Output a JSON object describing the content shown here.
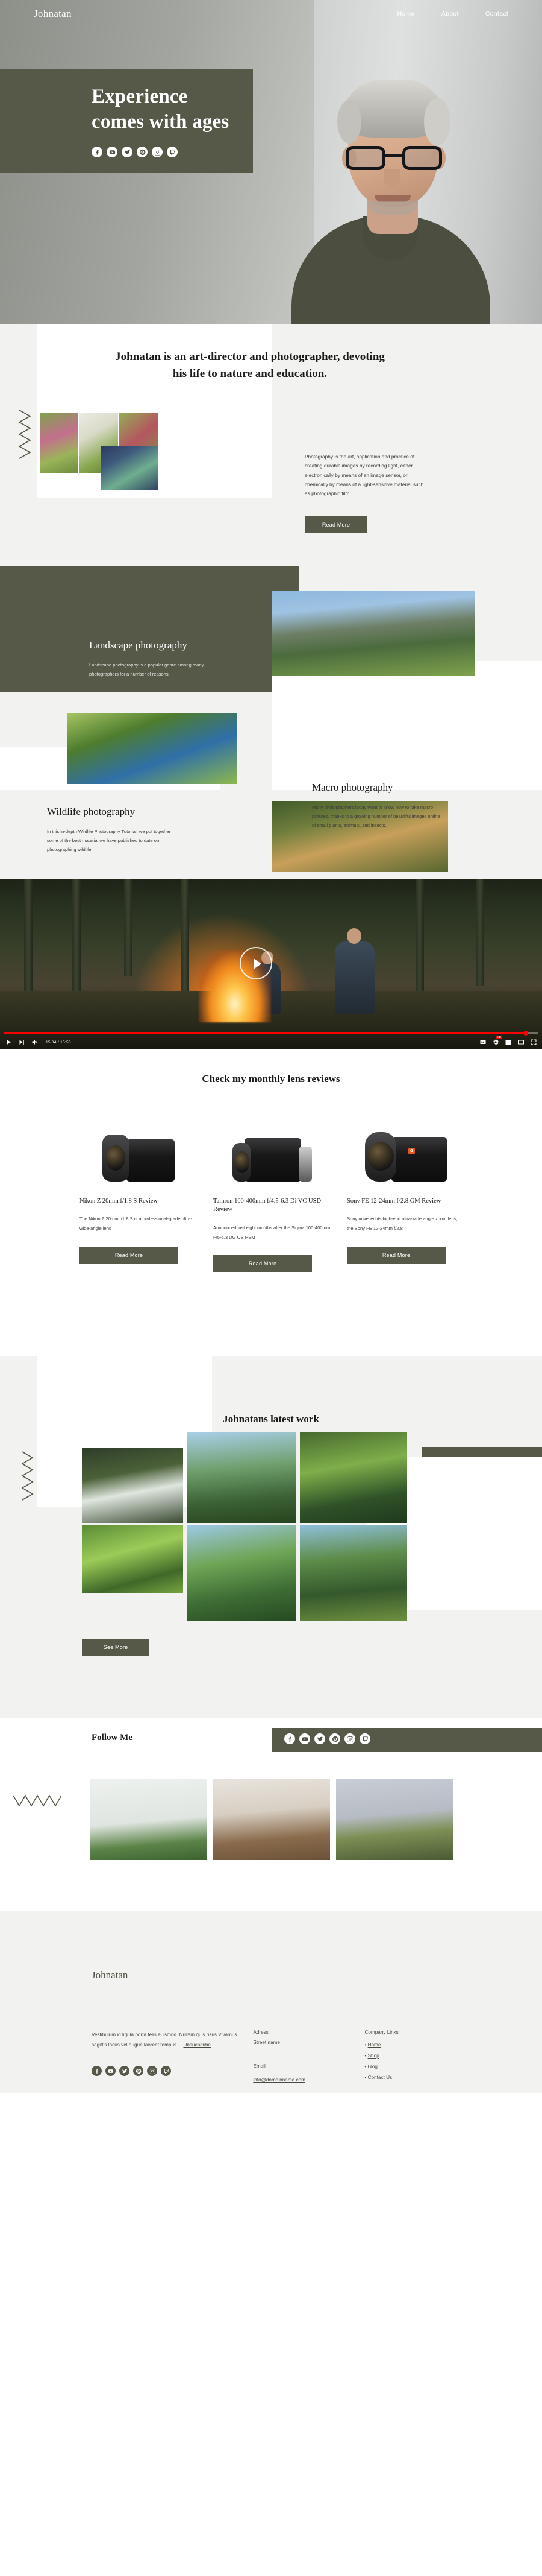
{
  "colors": {
    "olive": "#565948",
    "light_bg": "#f2f2f0",
    "white": "#ffffff",
    "accent_red": "#ff0000"
  },
  "nav": {
    "brand": "Johnatan",
    "links": [
      {
        "label": "Home"
      },
      {
        "label": "About"
      },
      {
        "label": "Contact"
      }
    ]
  },
  "hero": {
    "title_line1": "Experience",
    "title_line2": "comes with ages",
    "social": [
      {
        "name": "facebook-icon"
      },
      {
        "name": "youtube-icon"
      },
      {
        "name": "twitter-icon"
      },
      {
        "name": "pinterest-icon"
      },
      {
        "name": "instagram-icon"
      },
      {
        "name": "twitch-icon"
      }
    ]
  },
  "about": {
    "heading": "Johnatan is an art-director and photographer, devoting his life to nature and education.",
    "body": "Photography is the art, application and practice of creating durable images by recording light, either electronically by means of an image sensor, or chemically by means of a light-sensitive material such as photographic film.",
    "button": "Read More"
  },
  "categories": [
    {
      "title": "Landscape photography",
      "text": "Landscape photography is a popular genre among many photographers for a number of reasons."
    },
    {
      "title": "Macro photography",
      "text": "Many photographers today want to know how to take macro pictures, thanks to a growing number of beautiful images online of small plants, animals, and insects."
    },
    {
      "title": "Wildlife photography",
      "text": "In this in-depth Wildlife Photography Tutorial, we put together some of the best material we have published to date on photographing wildlife."
    }
  ],
  "video": {
    "time": "15:34 / 15:56",
    "controls_left": [
      {
        "name": "play-button"
      },
      {
        "name": "next-track-button"
      },
      {
        "name": "mute-button"
      }
    ],
    "controls_right": [
      {
        "name": "closed-captions-button",
        "label": "CC"
      },
      {
        "name": "settings-gear-button",
        "badge": "HD"
      },
      {
        "name": "miniplayer-button"
      },
      {
        "name": "theater-mode-button"
      },
      {
        "name": "fullscreen-button"
      }
    ]
  },
  "lens_section": {
    "heading": "Check my monthly lens reviews",
    "cards": [
      {
        "title": "Nikon Z 20mm f/1.8 S Review",
        "desc": "The Nikon Z 20mm f/1.8 S is a professional-grade ultra-wide-angle lens",
        "button": "Read More",
        "badge": ""
      },
      {
        "title": "Tamron 100-400mm f/4.5-6.3 Di VC USD Review",
        "desc": "Announced just eight months after the Sigma 100-400mm F/5-6.3 DG OS HSM",
        "button": "Read More",
        "badge": ""
      },
      {
        "title": "Sony FE 12-24mm f/2.8 GM Review",
        "desc": "Sony unveiled its high-end ultra-wide angle zoom lens, the Sony FE 12-24mm f/2.8",
        "button": "Read More",
        "badge": "G"
      }
    ]
  },
  "work": {
    "heading": "Johnatans latest work",
    "button": "See More"
  },
  "follow": {
    "heading": "Follow Me",
    "social": [
      {
        "name": "facebook-icon"
      },
      {
        "name": "youtube-icon"
      },
      {
        "name": "twitter-icon"
      },
      {
        "name": "pinterest-icon"
      },
      {
        "name": "instagram-icon"
      },
      {
        "name": "twitch-icon"
      }
    ]
  },
  "footer": {
    "brand": "Johnatan",
    "about_text": "Vestibulum id ligula porta felis euismod. Nullam quis risus Vivamus sagittis lacus vel augue laoreet tempus ...",
    "unsubscribe": "Unsucbcribe",
    "address_label": "Adress",
    "address_value": "Street name",
    "email_label": "Email",
    "email_value": "info@domainname.com",
    "links_label": "Company Links",
    "links": [
      {
        "label": "Home"
      },
      {
        "label": "Shop"
      },
      {
        "label": "Blog"
      },
      {
        "label": "Contact Us"
      }
    ],
    "social": [
      {
        "name": "facebook-icon"
      },
      {
        "name": "youtube-icon"
      },
      {
        "name": "twitter-icon"
      },
      {
        "name": "pinterest-icon"
      },
      {
        "name": "instagram-icon"
      },
      {
        "name": "twitch-icon"
      }
    ]
  }
}
